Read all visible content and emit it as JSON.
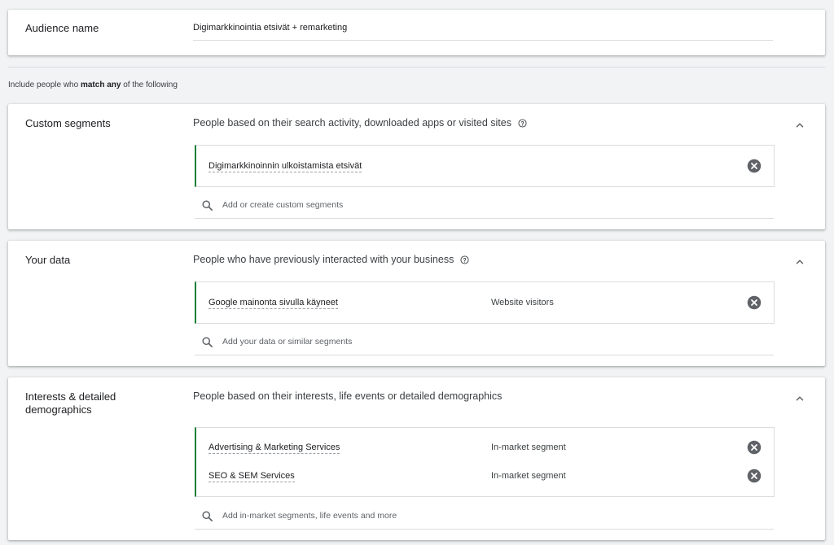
{
  "audience": {
    "label": "Audience name",
    "value": "Digimarkkinointia etsivät + remarketing"
  },
  "include_text": {
    "prefix": "Include people who ",
    "bold": "match any",
    "suffix": " of the following"
  },
  "sections": {
    "custom": {
      "title": "Custom segments",
      "description": "People based on their search activity, downloaded apps or visited sites",
      "items": [
        {
          "label": "Digimarkkinoinnin ulkoistamista etsivät",
          "type": ""
        }
      ],
      "search_placeholder": "Add or create custom segments"
    },
    "your_data": {
      "title": "Your data",
      "description": "People who have previously interacted with your business",
      "items": [
        {
          "label": "Google mainonta sivulla käyneet",
          "type": "Website visitors"
        }
      ],
      "search_placeholder": "Add your data or similar segments"
    },
    "interests": {
      "title_line1": "Interests & detailed",
      "title_line2": "demographics",
      "description": "People based on their interests, life events or detailed demographics",
      "items": [
        {
          "label": "Advertising & Marketing Services",
          "type": "In-market segment"
        },
        {
          "label": "SEO & SEM Services",
          "type": "In-market segment"
        }
      ],
      "search_placeholder": "Add in-market segments, life events and more"
    }
  },
  "icons": {
    "help": "help-circle-icon",
    "collapse": "chevron-up-icon",
    "remove": "close-circle-icon",
    "search": "search-icon"
  },
  "colors": {
    "accent_bar": "#188038",
    "remove_icon": "#5f6368",
    "background": "#f1f3f4"
  }
}
